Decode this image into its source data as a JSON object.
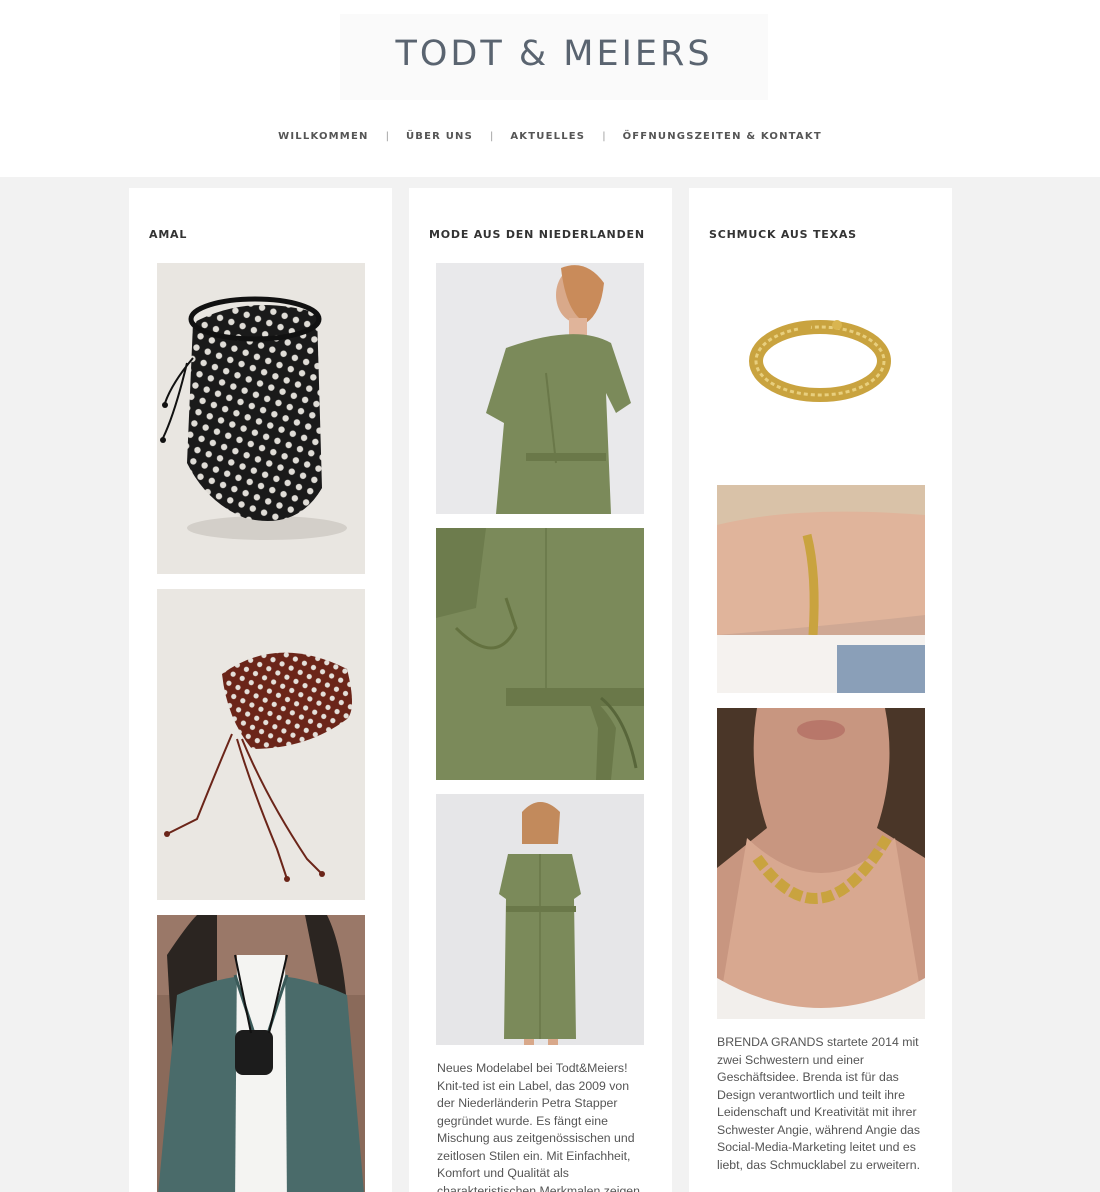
{
  "logo": {
    "text": "TODT & MEIERS"
  },
  "nav": {
    "items": [
      "WILLKOMMEN",
      "ÜBER UNS",
      "AKTUELLES",
      "ÖFFNUNGSZEITEN & KONTAKT"
    ],
    "separator": "|"
  },
  "columns": [
    {
      "title": "AMAL"
    },
    {
      "title": "MODE AUS DEN NIEDERLANDEN",
      "text": "Neues Modelabel bei Todt&Meiers! Knit-ted ist ein Label, das 2009 von der Niederländerin Petra Stapper gegründet wurde. Es fängt eine Mischung aus zeitgenössischen und zeitlosen Stilen ein. Mit Einfachheit, Komfort und Qualität als charakteristischen Merkmalen zeigen"
    },
    {
      "title": "SCHMUCK AUS TEXAS",
      "text": "BRENDA GRANDS startete 2014 mit zwei Schwestern und einer Geschäftsidee. Brenda  ist für das Design verantwortlich und teilt ihre Leidenschaft und Kreativität mit ihrer Schwester Angie, während Angie das Social-Media-Marketing leitet und es liebt, das Schmucklabel zu erweitern."
    }
  ],
  "colors": {
    "page_bg": "#f2f2f2",
    "logo_text": "#5a6470",
    "olive_dress": "#7b8a5a",
    "gold": "#c9a33f",
    "teal_blazer": "#4a6b6a"
  }
}
